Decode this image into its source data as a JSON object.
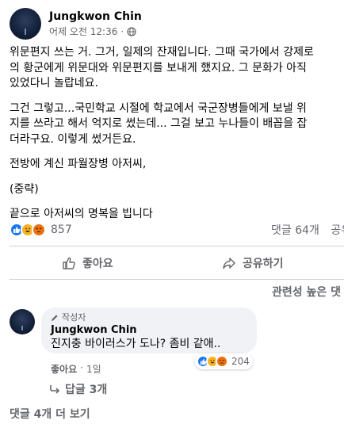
{
  "post": {
    "author": "Jungkwon Chin",
    "timestamp": "어제 오전 12:36",
    "separator": "·",
    "paragraphs": [
      "위문편지 쓰는 거. 그거, 일제의 잔재입니다. 그때 국가에서 강제로\n의 황군에게 위문대와 위문편지를 보내게 했지요. 그 문화가 아직\n있었다니 놀랍네요.",
      "그건 그렇고...국민학교 시절에 학교에서 국군장병들에게 보낼 위\n지를 쓰라고 해서 억지로 썼는데... 그걸 보고 누나들이 배꼽을 잡\n더라구요. 이렇게 썼거든요.",
      "전방에 계신 파월장병 아저씨,",
      "(중략)",
      "끝으로 아저씨의 명복을 빕니다"
    ],
    "reactions": {
      "count": "857",
      "types": [
        "like",
        "haha",
        "angry"
      ]
    },
    "comment_count": "댓글 64개",
    "share_count": "공유"
  },
  "actions": {
    "like_label": "좋아요",
    "share_label": "공유하기"
  },
  "sort": {
    "label": "관련성 높은 댓"
  },
  "comment": {
    "badge": "작성자",
    "author": "Jungkwon Chin",
    "text": "진지충 바이러스가 도나? 좀비 같애..",
    "reaction_count": "204",
    "like_label": "좋아요",
    "separator": "·",
    "age": "1일",
    "replies_label": "답글 3개"
  },
  "more_comments": "댓글 4개 더 보기",
  "colors": {
    "like": "#1877f2",
    "haha": "#f7b125",
    "angry": "#e9710f",
    "secondary_text": "#65676b",
    "bubble": "#f0f2f5"
  }
}
